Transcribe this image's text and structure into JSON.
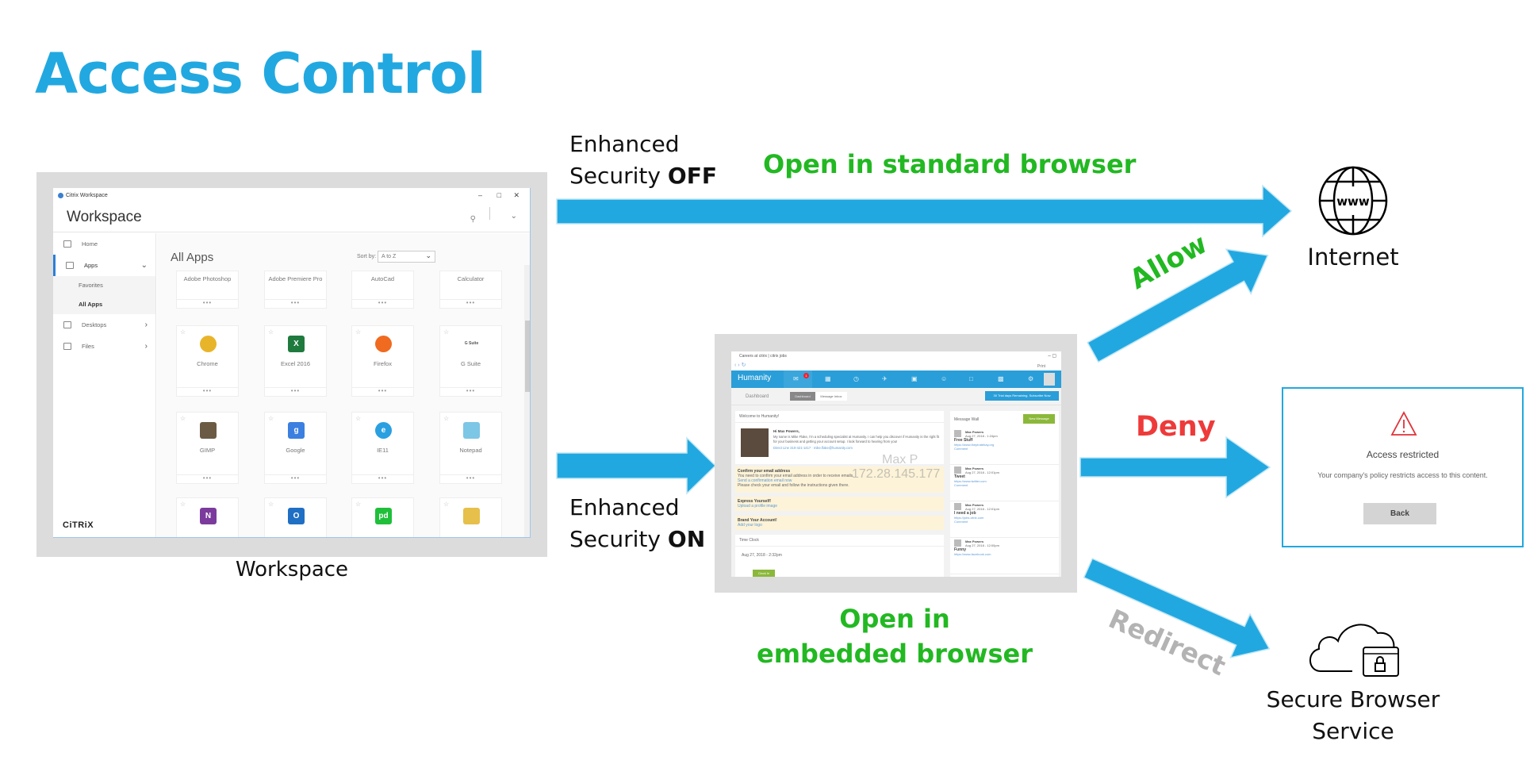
{
  "title": "Access Control",
  "labels": {
    "enhanced_off_line1": "Enhanced",
    "enhanced_off_line2": "Security",
    "enhanced_off_state": "OFF",
    "enhanced_on_line1": "Enhanced",
    "enhanced_on_line2": "Security",
    "enhanced_on_state": "ON",
    "open_standard": "Open in standard browser",
    "open_embedded_line1": "Open in",
    "open_embedded_line2": "embedded browser",
    "allow": "Allow",
    "deny": "Deny",
    "redirect": "Redirect",
    "internet": "Internet",
    "sbs_line1": "Secure Browser",
    "sbs_line2": "Service",
    "workspace_caption": "Workspace"
  },
  "colors": {
    "accent_blue": "#22a8e0",
    "green": "#22b822",
    "red": "#ee3a3a",
    "gray": "#b3b3b3"
  },
  "workspace": {
    "window_title": "Citrix Workspace",
    "header": "Workspace",
    "sidebar": [
      {
        "label": "Home",
        "icon": "home-icon"
      },
      {
        "label": "Apps",
        "icon": "apps-icon"
      },
      {
        "label": "Favorites"
      },
      {
        "label": "All Apps"
      },
      {
        "label": "Desktops",
        "icon": "desktop-icon"
      },
      {
        "label": "Files",
        "icon": "folder-icon"
      }
    ],
    "logo": "CiTRiX",
    "heading": "All Apps",
    "sort_label": "Sort by:",
    "sort_value": "A to Z",
    "apps": [
      {
        "name": "Adobe Photoshop"
      },
      {
        "name": "Adobe Premiere Pro"
      },
      {
        "name": "AutoCad"
      },
      {
        "name": "Calculator"
      },
      {
        "name": "Chrome",
        "icon": "chrome-icon",
        "glyph": "",
        "color": "#e8b52a"
      },
      {
        "name": "Excel 2016",
        "icon": "excel-icon",
        "glyph": "X",
        "color": "#1f7a3e"
      },
      {
        "name": "Firefox",
        "icon": "firefox-icon",
        "glyph": "",
        "color": "#f06a1f"
      },
      {
        "name": "G Suite",
        "icon": "gsuite-icon",
        "glyph": "G Suite",
        "color": ""
      },
      {
        "name": "GIMP",
        "icon": "gimp-icon",
        "glyph": "",
        "color": "#6b5b45"
      },
      {
        "name": "Google",
        "icon": "google-icon",
        "glyph": "g",
        "color": "#3b7fe0"
      },
      {
        "name": "IE11",
        "icon": "ie-icon",
        "glyph": "e",
        "color": "#2aa0e0"
      },
      {
        "name": "Notepad",
        "icon": "notepad-icon",
        "glyph": "",
        "color": "#7cc6e6"
      },
      {
        "name": "",
        "icon": "onenote-icon",
        "glyph": "N",
        "color": "#7b3b9c"
      },
      {
        "name": "",
        "icon": "outlook-icon",
        "glyph": "O",
        "color": "#1f6fc4"
      },
      {
        "name": "",
        "icon": "pagerduty-icon",
        "glyph": "pd",
        "color": "#1fbf3a"
      },
      {
        "name": "",
        "icon": "paint-icon",
        "glyph": "",
        "color": "#e6c04a"
      }
    ]
  },
  "embedded": {
    "tab_title": "Careers at citrix | citrix jobs",
    "print": "Print",
    "brand": "Humanity",
    "badge": "1",
    "page": "Dashboard",
    "tabs": [
      "Dashboard",
      "Message Inbox"
    ],
    "trial": "30 Trial days Remaining. Subscribe Now",
    "welcome": "Welcome to Humanity!",
    "greeting": "Hi Max Powers,",
    "intro": "My name is Mike Flake, I'm a scheduling specialist at Humanity. I can help you discover if Humanity is the right fit for your business and getting your account setup. I look forward to hearing from you!",
    "contact": "Direct Line 310-421-1417 · mike.flake@humanity.com",
    "watermark_name": "Max P",
    "watermark_ip": "172.28.145.177",
    "tasks": [
      {
        "title": "Confirm your email address",
        "lines": [
          "You need to confirm your email address in order to receive emails.",
          "Send a confirmation email now",
          "Please check your email and follow the instructions given there."
        ]
      },
      {
        "title": "Express Yourself!",
        "lines": [
          "Upload a profile image"
        ]
      },
      {
        "title": "Brand Your Account!",
        "lines": [
          "Add your logo"
        ]
      }
    ],
    "timeclock": "Time Clock",
    "timeclock_date": "Aug 27, 2018 - 2:32pm",
    "clockin": "Clock In",
    "wall": "Message Wall",
    "new_message": "New Message",
    "posts": [
      {
        "author": "Max Powers",
        "date": "Aug 27, 2018 - 1:24pm",
        "title": "Free Stuff",
        "link": "https://www.thepiratebay.org",
        "comment": "Comment"
      },
      {
        "author": "Max Powers",
        "date": "Aug 27, 2018 - 12:01pm",
        "title": "Tweet",
        "link": "https://www.twitter.com",
        "comment": "Comment"
      },
      {
        "author": "Max Powers",
        "date": "Aug 27, 2018 - 12:01pm",
        "title": "I need a job",
        "link": "https://jobs.citrix.com",
        "comment": "Comment"
      },
      {
        "author": "Max Powers",
        "date": "Aug 27, 2018 - 12:00pm",
        "title": "Funny",
        "link": "https://www.facebook.com"
      }
    ]
  },
  "restricted": {
    "icon": "warning-icon",
    "heading": "Access restricted",
    "message": "Your company's policy restricts access to this content.",
    "button": "Back"
  }
}
